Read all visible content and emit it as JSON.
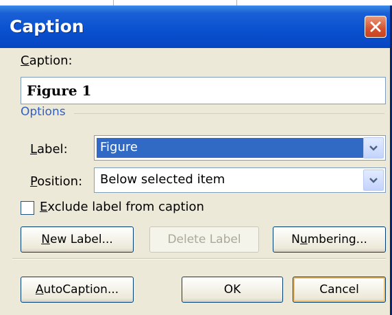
{
  "window": {
    "title": "Caption"
  },
  "caption": {
    "label": "Caption:",
    "value": "Figure 1"
  },
  "options": {
    "legend": "Options",
    "label_label": "Label:",
    "label_value": "Figure",
    "position_label": "Position:",
    "position_value": "Below selected item"
  },
  "exclude": {
    "label": "Exclude label from caption",
    "checked": false
  },
  "buttons": {
    "new_label": "New Label...",
    "delete_label": "Delete Label",
    "numbering": "Numbering...",
    "autocaption": "AutoCaption...",
    "ok": "OK",
    "cancel": "Cancel"
  },
  "colors": {
    "titlebar": "#0a52d0",
    "accent_text": "#2d5fc7",
    "selection": "#316ac5",
    "close_button": "#d3522f"
  },
  "icons": {
    "close": "close-icon",
    "dropdown": "chevron-down-icon"
  }
}
